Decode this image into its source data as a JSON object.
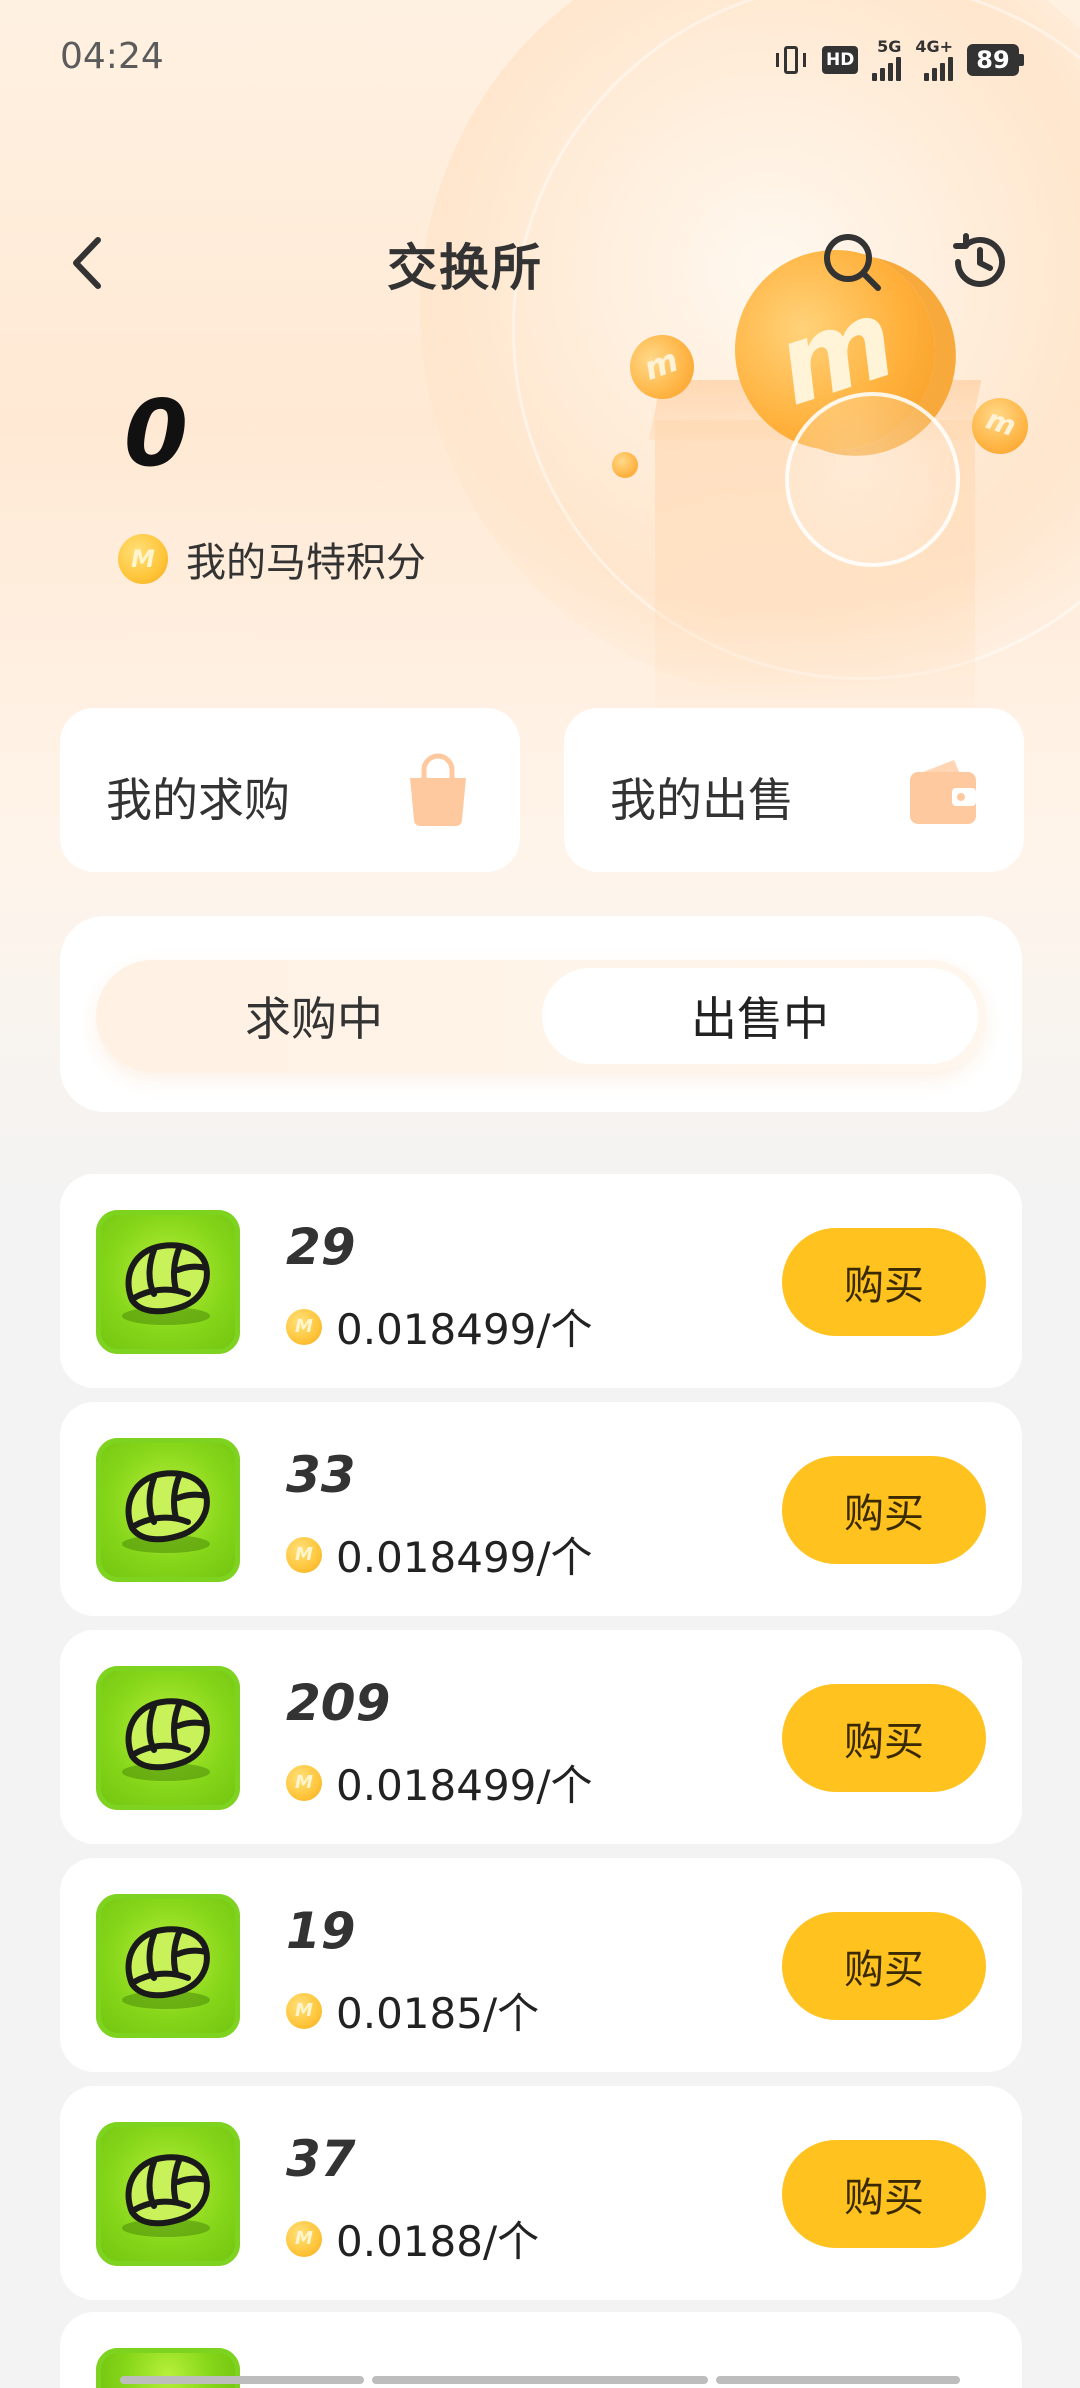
{
  "status_bar": {
    "time": "04:24",
    "hd_label": "HD",
    "sim1_label": "5G",
    "sim2_label": "4G+",
    "battery": "89"
  },
  "header": {
    "title": "交换所",
    "back_icon": "chevron-left-icon",
    "search_icon": "search-icon",
    "history_icon": "history-clock-icon"
  },
  "points": {
    "value": "0",
    "label": "我的马特积分",
    "coin_icon": "m-coin-icon"
  },
  "quick_actions": {
    "my_buy": {
      "label": "我的求购",
      "icon": "shopping-bag-icon"
    },
    "my_sell": {
      "label": "我的出售",
      "icon": "wallet-icon"
    }
  },
  "tabs": {
    "buying": "求购中",
    "selling": "出售中",
    "active": "selling"
  },
  "listings": [
    {
      "quantity": "29",
      "price": "0.018499/个",
      "button": "购买"
    },
    {
      "quantity": "33",
      "price": "0.018499/个",
      "button": "购买"
    },
    {
      "quantity": "209",
      "price": "0.018499/个",
      "button": "购买"
    },
    {
      "quantity": "19",
      "price": "0.0185/个",
      "button": "购买"
    },
    {
      "quantity": "37",
      "price": "0.0188/个",
      "button": "购买"
    }
  ],
  "colors": {
    "accent": "#ffc21f",
    "item_icon_green": "#86d61a",
    "text_primary": "#333333"
  }
}
